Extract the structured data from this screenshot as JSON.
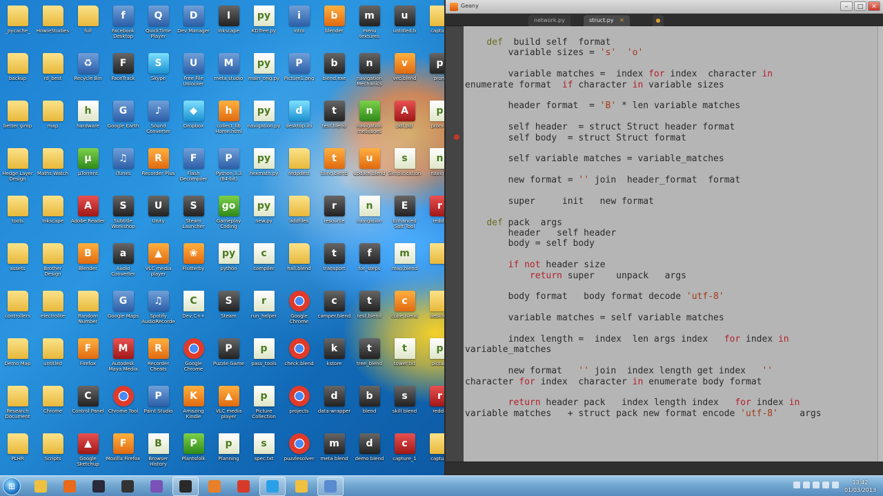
{
  "desktop": {
    "icons": [
      {
        "label": "_pycache_",
        "type": "folder"
      },
      {
        "label": "HowieStudies",
        "type": "folder"
      },
      {
        "label": "full",
        "type": "folder"
      },
      {
        "label": "Facebook Desktop",
        "type": "app",
        "glyph": "f"
      },
      {
        "label": "QuickTime Player",
        "type": "app",
        "glyph": "Q"
      },
      {
        "label": "Dev Manager",
        "type": "app",
        "glyph": "D"
      },
      {
        "label": "Inkscape",
        "type": "dark",
        "glyph": "I"
      },
      {
        "label": "KDTree.py",
        "type": "file",
        "glyph": "py"
      },
      {
        "label": "intro",
        "type": "app",
        "glyph": "i"
      },
      {
        "label": "blender",
        "type": "orange",
        "glyph": "b"
      },
      {
        "label": "menu textures",
        "type": "dark",
        "glyph": "m"
      },
      {
        "label": "untitled.b",
        "type": "dark",
        "glyph": "u"
      },
      {
        "label": "capture",
        "type": "folder"
      },
      {
        "label": "",
        "type": "folder"
      },
      {
        "label": "backup",
        "type": "folder"
      },
      {
        "label": "rd_best",
        "type": "folder"
      },
      {
        "label": "Recycle Bin",
        "type": "app",
        "glyph": "♻"
      },
      {
        "label": "FaceTrack",
        "type": "dark",
        "glyph": "F"
      },
      {
        "label": "Skype",
        "type": "cyan",
        "glyph": "S"
      },
      {
        "label": "Free File Unlocker",
        "type": "app",
        "glyph": "U"
      },
      {
        "label": "meta studio",
        "type": "app",
        "glyph": "M"
      },
      {
        "label": "main_orig.py",
        "type": "file",
        "glyph": "py"
      },
      {
        "label": "Picture1.png",
        "type": "app",
        "glyph": "P"
      },
      {
        "label": "blend.exe",
        "type": "dark",
        "glyph": "b"
      },
      {
        "label": "navigation Mechanics",
        "type": "dark",
        "glyph": "n"
      },
      {
        "label": "vec.blend",
        "type": "orange",
        "glyph": "v"
      },
      {
        "label": "prom",
        "type": "dark",
        "glyph": "p"
      },
      {
        "label": "",
        "type": "folder"
      },
      {
        "label": "better gimp",
        "type": "folder"
      },
      {
        "label": "map",
        "type": "folder"
      },
      {
        "label": "hardware",
        "type": "file",
        "glyph": "h"
      },
      {
        "label": "Google Earth",
        "type": "app",
        "glyph": "G"
      },
      {
        "label": "Sound Converter",
        "type": "app",
        "glyph": "♪"
      },
      {
        "label": "Dropbox",
        "type": "cyan",
        "glyph": "◆"
      },
      {
        "label": "collect_lib Home.html",
        "type": "orange",
        "glyph": "h"
      },
      {
        "label": "navigation.py",
        "type": "file",
        "glyph": "py"
      },
      {
        "label": "desktop.ini",
        "type": "cyan",
        "glyph": "d"
      },
      {
        "label": "test.blend",
        "type": "dark",
        "glyph": "t"
      },
      {
        "label": "navigation messages",
        "type": "green",
        "glyph": "n"
      },
      {
        "label": "pdf.pdf",
        "type": "red",
        "glyph": "A"
      },
      {
        "label": "prom_a",
        "type": "file",
        "glyph": "p"
      },
      {
        "label": "",
        "type": "folder"
      },
      {
        "label": "Hedge Layer Design",
        "type": "folder"
      },
      {
        "label": "Maths Watch",
        "type": "folder"
      },
      {
        "label": "µTorrent",
        "type": "green",
        "glyph": "µ"
      },
      {
        "label": "iTunes",
        "type": "app",
        "glyph": "♫"
      },
      {
        "label": "Recorder Plus",
        "type": "orange",
        "glyph": "R"
      },
      {
        "label": "Flash Decompiler",
        "type": "app",
        "glyph": "F"
      },
      {
        "label": "Python 3.3 (64-bit)",
        "type": "app",
        "glyph": "P"
      },
      {
        "label": "hexmath.py",
        "type": "file",
        "glyph": "py"
      },
      {
        "label": "redpdest",
        "type": "folder"
      },
      {
        "label": "tiling.blend",
        "type": "orange",
        "glyph": "t"
      },
      {
        "label": "update.blend",
        "type": "orange",
        "glyph": "u"
      },
      {
        "label": "Simplification",
        "type": "file",
        "glyph": "s"
      },
      {
        "label": "navigat",
        "type": "file",
        "glyph": "n"
      },
      {
        "label": "",
        "type": "folder"
      },
      {
        "label": "tools",
        "type": "folder"
      },
      {
        "label": "Inkscape",
        "type": "folder"
      },
      {
        "label": "Adobe Reader",
        "type": "red",
        "glyph": "A"
      },
      {
        "label": "Subtitle Workshop",
        "type": "dark",
        "glyph": "S"
      },
      {
        "label": "Unity",
        "type": "dark",
        "glyph": "U"
      },
      {
        "label": "Steam Launcher",
        "type": "dark",
        "glyph": "S"
      },
      {
        "label": "Gameplay Coding",
        "type": "green",
        "glyph": "go"
      },
      {
        "label": "new.py",
        "type": "file",
        "glyph": "py"
      },
      {
        "label": "addfiles",
        "type": "folder"
      },
      {
        "label": "resource",
        "type": "dark",
        "glyph": "r"
      },
      {
        "label": "navigation",
        "type": "file",
        "glyph": "n"
      },
      {
        "label": "Enhanced Soft Tool",
        "type": "dark",
        "glyph": "E"
      },
      {
        "label": "reddit",
        "type": "red",
        "glyph": "r"
      },
      {
        "label": "",
        "type": "folder"
      },
      {
        "label": "assets",
        "type": "folder"
      },
      {
        "label": "Brother Design",
        "type": "folder"
      },
      {
        "label": "Blender",
        "type": "orange",
        "glyph": "B"
      },
      {
        "label": "Audio Converter",
        "type": "dark",
        "glyph": "a"
      },
      {
        "label": "VLC media player",
        "type": "orange",
        "glyph": "▲"
      },
      {
        "label": "Flutterby",
        "type": "orange",
        "glyph": "❀"
      },
      {
        "label": "python",
        "type": "file",
        "glyph": "py"
      },
      {
        "label": "compiler",
        "type": "file",
        "glyph": "c"
      },
      {
        "label": "hall.blend",
        "type": "folder"
      },
      {
        "label": "transport",
        "type": "dark",
        "glyph": "t"
      },
      {
        "label": "for_steps",
        "type": "dark",
        "glyph": "f"
      },
      {
        "label": "map.blend",
        "type": "file",
        "glyph": "m"
      },
      {
        "label": "",
        "type": "folder"
      },
      {
        "label": "",
        "type": "folder"
      },
      {
        "label": "controllers",
        "type": "folder"
      },
      {
        "label": "electrolite",
        "type": "folder"
      },
      {
        "label": "Random Number",
        "type": "folder"
      },
      {
        "label": "Google Maps",
        "type": "app",
        "glyph": "G"
      },
      {
        "label": "Spotify AudioRecorder",
        "type": "app",
        "glyph": "♫"
      },
      {
        "label": "Dev C++",
        "type": "file",
        "glyph": "C"
      },
      {
        "label": "Steam",
        "type": "dark",
        "glyph": "S"
      },
      {
        "label": "run_helper",
        "type": "file",
        "glyph": "r"
      },
      {
        "label": "Google Chrome",
        "type": "chrome",
        "glyph": ""
      },
      {
        "label": "camper.blend",
        "type": "dark",
        "glyph": "c"
      },
      {
        "label": "test.blend",
        "type": "dark",
        "glyph": "t"
      },
      {
        "label": "cube.blend",
        "type": "orange",
        "glyph": "c"
      },
      {
        "label": "desktop",
        "type": "folder"
      },
      {
        "label": "",
        "type": "folder"
      },
      {
        "label": "Demo Map",
        "type": "folder"
      },
      {
        "label": "untitled",
        "type": "folder"
      },
      {
        "label": "Firefox",
        "type": "orange",
        "glyph": "F"
      },
      {
        "label": "Autodesk Maya Media Station",
        "type": "red",
        "glyph": "M"
      },
      {
        "label": "Recorder Cheats",
        "type": "orange",
        "glyph": "R"
      },
      {
        "label": "Google Chrome",
        "type": "chrome",
        "glyph": ""
      },
      {
        "label": "Puzzle Game",
        "type": "dark",
        "glyph": "P"
      },
      {
        "label": "pass_tools",
        "type": "file",
        "glyph": "p"
      },
      {
        "label": "check.blend",
        "type": "chrome",
        "glyph": ""
      },
      {
        "label": "kstore",
        "type": "dark",
        "glyph": "k"
      },
      {
        "label": "tree_blend",
        "type": "dark",
        "glyph": "t"
      },
      {
        "label": "tower.txt",
        "type": "file",
        "glyph": "t"
      },
      {
        "label": "picture",
        "type": "file",
        "glyph": "p"
      },
      {
        "label": "",
        "type": "folder"
      },
      {
        "label": "Research Document",
        "type": "folder"
      },
      {
        "label": "Chrome",
        "type": "folder"
      },
      {
        "label": "Control Panel",
        "type": "dark",
        "glyph": "C"
      },
      {
        "label": "Chrome Tool",
        "type": "chrome",
        "glyph": ""
      },
      {
        "label": "Paint Studio",
        "type": "app",
        "glyph": "P"
      },
      {
        "label": "Amazing Kindle",
        "type": "orange",
        "glyph": "K"
      },
      {
        "label": "VLC media player",
        "type": "orange",
        "glyph": "▲"
      },
      {
        "label": "Picture Collection",
        "type": "file",
        "glyph": "p"
      },
      {
        "label": "projects",
        "type": "chrome",
        "glyph": ""
      },
      {
        "label": "data-wrapper",
        "type": "dark",
        "glyph": "d"
      },
      {
        "label": "blend",
        "type": "dark",
        "glyph": "b"
      },
      {
        "label": "skill blend",
        "type": "dark",
        "glyph": "s"
      },
      {
        "label": "reddit",
        "type": "red",
        "glyph": "r"
      },
      {
        "label": "",
        "type": "folder"
      },
      {
        "label": "PLHR",
        "type": "folder"
      },
      {
        "label": "Scripts",
        "type": "folder"
      },
      {
        "label": "Google Sketchup",
        "type": "red",
        "glyph": "▲"
      },
      {
        "label": "Mozilla Firefox",
        "type": "orange",
        "glyph": "F"
      },
      {
        "label": "Browser History",
        "type": "file",
        "glyph": "B"
      },
      {
        "label": "Plantsfolk",
        "type": "green",
        "glyph": "P"
      },
      {
        "label": "Planning",
        "type": "file",
        "glyph": "p"
      },
      {
        "label": "spec.txt",
        "type": "file",
        "glyph": "s"
      },
      {
        "label": "puzzlesolver",
        "type": "chrome",
        "glyph": ""
      },
      {
        "label": "meta blend",
        "type": "dark",
        "glyph": "m"
      },
      {
        "label": "demo blend",
        "type": "dark",
        "glyph": "d"
      },
      {
        "label": "capture_1",
        "type": "red",
        "glyph": "c"
      },
      {
        "label": "capture",
        "type": "folder"
      },
      {
        "label": "",
        "type": "folder"
      }
    ]
  },
  "editor": {
    "title": "Geany",
    "tabs": [
      {
        "label": "network.py",
        "active": false
      },
      {
        "label": "struct.py",
        "active": true
      },
      {
        "label": "",
        "active": false
      }
    ],
    "code_lines": [
      [
        {
          "t": "    "
        },
        {
          "t": "def",
          "c": "dec"
        },
        {
          "t": "  build self  format"
        }
      ],
      [
        {
          "t": "        variable sizes = "
        },
        {
          "t": "'s'",
          "c": "str"
        },
        {
          "t": "  "
        },
        {
          "t": "'o'",
          "c": "str"
        }
      ],
      [
        {
          "t": ""
        }
      ],
      [
        {
          "t": "        variable matches =  index "
        },
        {
          "t": "for",
          "c": "kw"
        },
        {
          "t": " index  character "
        },
        {
          "t": "in",
          "c": "kw"
        }
      ],
      [
        {
          "t": "enumerate format  "
        },
        {
          "t": "if",
          "c": "kw"
        },
        {
          "t": " character "
        },
        {
          "t": "in",
          "c": "kw"
        },
        {
          "t": " variable sizes"
        }
      ],
      [
        {
          "t": ""
        }
      ],
      [
        {
          "t": "        header format  = "
        },
        {
          "t": "'B'",
          "c": "str"
        },
        {
          "t": " * len variable matches"
        }
      ],
      [
        {
          "t": ""
        }
      ],
      [
        {
          "t": "        self header  = struct Struct header format"
        }
      ],
      [
        {
          "t": "        self body  = struct Struct format"
        }
      ],
      [
        {
          "t": ""
        }
      ],
      [
        {
          "t": "        self variable matches = variable_matches"
        }
      ],
      [
        {
          "t": ""
        }
      ],
      [
        {
          "t": "        new format = "
        },
        {
          "t": "''",
          "c": "str"
        },
        {
          "t": " join  header_format  format"
        }
      ],
      [
        {
          "t": ""
        }
      ],
      [
        {
          "t": "        super     init   new format"
        }
      ],
      [
        {
          "t": ""
        }
      ],
      [
        {
          "t": "    "
        },
        {
          "t": "def",
          "c": "dec"
        },
        {
          "t": " pack  args"
        }
      ],
      [
        {
          "t": "        header   self header"
        }
      ],
      [
        {
          "t": "        body = self body"
        }
      ],
      [
        {
          "t": ""
        }
      ],
      [
        {
          "t": "        "
        },
        {
          "t": "if not",
          "c": "kw"
        },
        {
          "t": " header size"
        }
      ],
      [
        {
          "t": "            "
        },
        {
          "t": "return",
          "c": "kw"
        },
        {
          "t": " super    unpack   args"
        }
      ],
      [
        {
          "t": ""
        }
      ],
      [
        {
          "t": "        body format   body format decode "
        },
        {
          "t": "'utf-8'",
          "c": "str"
        }
      ],
      [
        {
          "t": ""
        }
      ],
      [
        {
          "t": "        variable matches = self variable matches"
        }
      ],
      [
        {
          "t": ""
        }
      ],
      [
        {
          "t": "        index length =  index  len args index   "
        },
        {
          "t": "for",
          "c": "kw"
        },
        {
          "t": " index "
        },
        {
          "t": "in",
          "c": "kw"
        }
      ],
      [
        {
          "t": "variable_matches"
        }
      ],
      [
        {
          "t": ""
        }
      ],
      [
        {
          "t": "        new format   "
        },
        {
          "t": "''",
          "c": "str"
        },
        {
          "t": " join  index length get index   "
        },
        {
          "t": "''",
          "c": "str"
        }
      ],
      [
        {
          "t": "character "
        },
        {
          "t": "for",
          "c": "kw"
        },
        {
          "t": " index  character "
        },
        {
          "t": "in",
          "c": "kw"
        },
        {
          "t": " enumerate body format"
        }
      ],
      [
        {
          "t": ""
        }
      ],
      [
        {
          "t": "        "
        },
        {
          "t": "return",
          "c": "kw"
        },
        {
          "t": " header pack   index length index   "
        },
        {
          "t": "for",
          "c": "kw"
        },
        {
          "t": " index "
        },
        {
          "t": "in",
          "c": "kw"
        }
      ],
      [
        {
          "t": "variable matches   + struct pack new format encode "
        },
        {
          "t": "'utf-8'",
          "c": "str"
        },
        {
          "t": "    args"
        }
      ]
    ],
    "status": {
      "left": "",
      "middle": "",
      "right": ""
    }
  },
  "taskbar": {
    "start_glyph": "⊞",
    "items": [
      {
        "name": "explorer",
        "color": "#f0c040",
        "active": false
      },
      {
        "name": "firefox",
        "color": "#e86a1a",
        "active": false
      },
      {
        "name": "steam",
        "color": "#2a2a3a",
        "active": false
      },
      {
        "name": "unity",
        "color": "#333333",
        "active": false
      },
      {
        "name": "pidgin",
        "color": "#7a52b8",
        "active": false
      },
      {
        "name": "terminal",
        "color": "#2a2a2a",
        "active": true
      },
      {
        "name": "vlc",
        "color": "#e8802a",
        "active": false
      },
      {
        "name": "chrome",
        "color": "#d83a2a",
        "active": false
      },
      {
        "name": "skype",
        "color": "#2aa0e8",
        "active": true
      },
      {
        "name": "folder",
        "color": "#f0c040",
        "active": false
      },
      {
        "name": "geany",
        "color": "#5a8ad0",
        "active": true
      }
    ],
    "clock_time": "13:42",
    "clock_date": "01/03/2013"
  }
}
